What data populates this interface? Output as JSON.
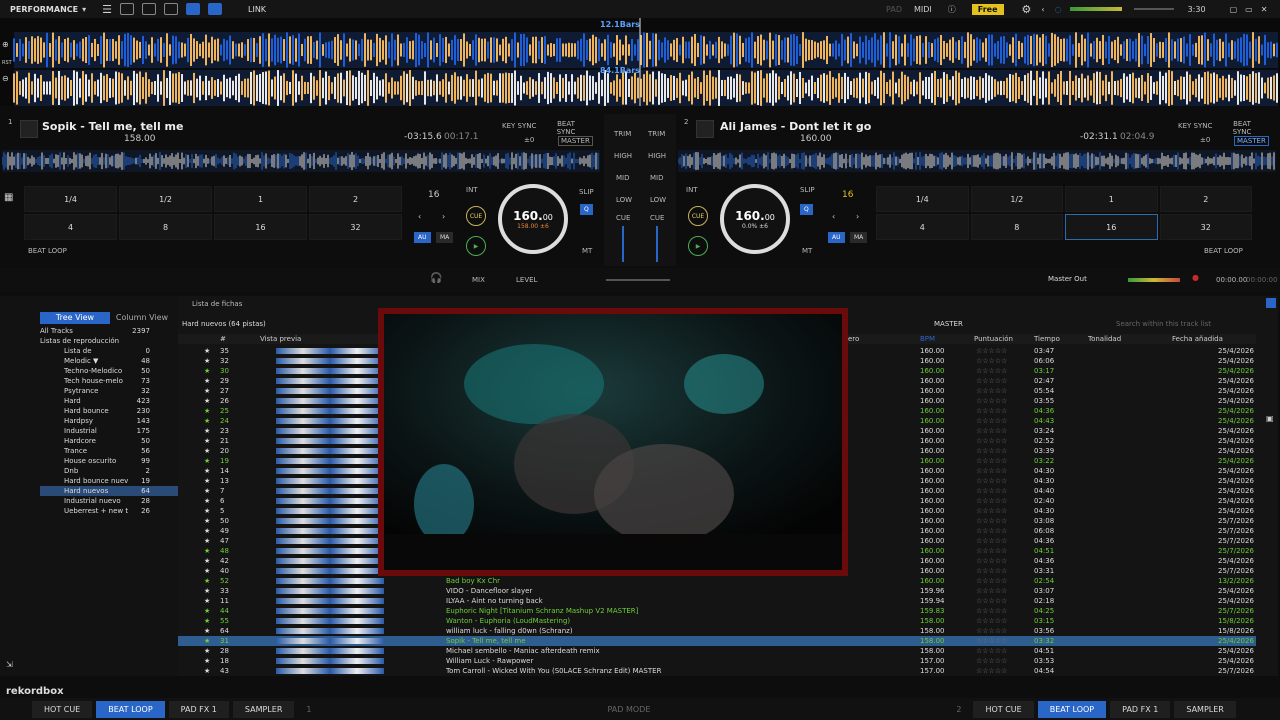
{
  "topbar": {
    "mode": "PERFORMANCE",
    "link": "LINK",
    "pad": "PAD",
    "midi": "MIDI",
    "plan": "Free",
    "time": "3:30"
  },
  "waveform": {
    "deck1_label": "12.1Bars",
    "deck2_label": "84.1Bars",
    "rst": "RST"
  },
  "deck1": {
    "number": "1",
    "title": "Sopik - Tell me, tell me",
    "bpm": "158.00",
    "remain": "-03:15.6",
    "elapsed": "00:17.1",
    "key_sync": "KEY SYNC",
    "beat_sync": "BEAT SYNC",
    "pm": "±0",
    "master": "MASTER",
    "jog_bpm": "160.",
    "jog_dec": "00",
    "jog_sub": "158.00 ±6",
    "loop": "16",
    "int": "INT",
    "slip": "SLIP",
    "cue": "CUE",
    "q": "Q",
    "au": "AU",
    "ma": "MA",
    "mt": "MT",
    "beat_loop": "BEAT LOOP",
    "pads": [
      "1/4",
      "1/2",
      "1",
      "2",
      "4",
      "8",
      "16",
      "32"
    ]
  },
  "deck2": {
    "number": "2",
    "title": "Ali James - Dont let it go",
    "bpm": "160.00",
    "remain": "-02:31.1",
    "elapsed": "02:04.9",
    "key_sync": "KEY SYNC",
    "beat_sync": "BEAT SYNC",
    "pm": "±0",
    "master": "MASTER",
    "jog_bpm": "160.",
    "jog_dec": "00",
    "jog_sub": "0.0% ±6",
    "loop": "16",
    "int": "INT",
    "slip": "SLIP",
    "cue": "CUE",
    "q": "Q",
    "au": "AU",
    "ma": "MA",
    "mt": "MT",
    "beat_loop": "BEAT LOOP",
    "pads": [
      "1/4",
      "1/2",
      "1",
      "2",
      "4",
      "8",
      "16",
      "32"
    ]
  },
  "mixer": {
    "trim": "TRIM",
    "high": "HIGH",
    "mid": "MID",
    "low": "LOW",
    "cue": "CUE",
    "mix": "MIX",
    "level": "LEVEL",
    "master_out": "Master Out",
    "rec_time": "00:00.00",
    "rec_time2": "00:00:00"
  },
  "browser": {
    "tree_view": "Tree View",
    "column_view": "Column View",
    "list_header": "Lista de fichas",
    "playlist_name": "Hard nuevos (64 pistas)",
    "master": "MASTER",
    "search_placeholder": "Search within this track list",
    "tree": [
      {
        "name": "All Tracks",
        "count": "2397"
      },
      {
        "name": "Listas de reproducción",
        "count": ""
      },
      {
        "name": "Lista de",
        "count": "0"
      },
      {
        "name": "Melodic ▼",
        "count": "48"
      },
      {
        "name": "Techno-Melodico",
        "count": "50"
      },
      {
        "name": "Tech house-melo",
        "count": "73"
      },
      {
        "name": "Psytrance",
        "count": "32"
      },
      {
        "name": "Hard",
        "count": "423"
      },
      {
        "name": "Hard bounce",
        "count": "230"
      },
      {
        "name": "Hardpsy",
        "count": "143"
      },
      {
        "name": "Industrial",
        "count": "175"
      },
      {
        "name": "Hardcore",
        "count": "50"
      },
      {
        "name": "Trance",
        "count": "56"
      },
      {
        "name": "House oscurito",
        "count": "99"
      },
      {
        "name": "Dnb",
        "count": "2"
      },
      {
        "name": "Hard bounce nuev",
        "count": "19"
      },
      {
        "name": "Hard nuevos",
        "count": "64"
      },
      {
        "name": "Industrial nuevo",
        "count": "28"
      },
      {
        "name": "Ueberrest + new t",
        "count": "26"
      }
    ],
    "columns": [
      "#",
      "Vista previa",
      "ero",
      "BPM",
      "Puntuación",
      "Tiempo",
      "Tonalidad",
      "Fecha añadida"
    ],
    "rows": [
      {
        "n": "35",
        "title": "",
        "bpm": "160.00",
        "time": "03:47",
        "date": "25/4/2026",
        "green": false
      },
      {
        "n": "32",
        "title": "",
        "bpm": "160.00",
        "time": "06:06",
        "date": "25/4/2026",
        "green": false
      },
      {
        "n": "30",
        "title": "",
        "bpm": "160.00",
        "time": "03:17",
        "date": "25/4/2026",
        "green": true
      },
      {
        "n": "29",
        "title": "",
        "bpm": "160.00",
        "time": "02:47",
        "date": "25/4/2026",
        "green": false
      },
      {
        "n": "27",
        "title": "",
        "bpm": "160.00",
        "time": "05:54",
        "date": "25/4/2026",
        "green": false
      },
      {
        "n": "26",
        "title": "",
        "bpm": "160.00",
        "time": "03:55",
        "date": "25/4/2026",
        "green": false
      },
      {
        "n": "25",
        "title": "",
        "bpm": "160.00",
        "time": "04:36",
        "date": "25/4/2026",
        "green": true
      },
      {
        "n": "24",
        "title": "",
        "bpm": "160.00",
        "time": "04:43",
        "date": "25/4/2026",
        "green": true
      },
      {
        "n": "23",
        "title": "",
        "bpm": "160.00",
        "time": "03:24",
        "date": "25/4/2026",
        "green": false
      },
      {
        "n": "21",
        "title": "",
        "bpm": "160.00",
        "time": "02:52",
        "date": "25/4/2026",
        "green": false
      },
      {
        "n": "20",
        "title": "",
        "bpm": "160.00",
        "time": "03:39",
        "date": "25/4/2026",
        "green": false
      },
      {
        "n": "19",
        "title": "",
        "bpm": "160.00",
        "time": "03:22",
        "date": "25/4/2026",
        "green": true
      },
      {
        "n": "14",
        "title": "",
        "bpm": "160.00",
        "time": "04:30",
        "date": "25/4/2026",
        "green": false
      },
      {
        "n": "13",
        "title": "",
        "bpm": "160.00",
        "time": "04:30",
        "date": "25/4/2026",
        "green": false
      },
      {
        "n": "7",
        "title": "",
        "bpm": "160.00",
        "time": "04:40",
        "date": "25/4/2026",
        "green": false
      },
      {
        "n": "6",
        "title": "",
        "bpm": "160.00",
        "time": "02:40",
        "date": "25/4/2026",
        "green": false
      },
      {
        "n": "5",
        "title": "",
        "bpm": "160.00",
        "time": "04:30",
        "date": "25/4/2026",
        "green": false
      },
      {
        "n": "50",
        "title": "",
        "bpm": "160.00",
        "time": "03:08",
        "date": "25/7/2026",
        "green": false
      },
      {
        "n": "49",
        "title": "",
        "bpm": "160.00",
        "time": "06:08",
        "date": "25/7/2026",
        "green": false
      },
      {
        "n": "47",
        "title": "",
        "bpm": "160.00",
        "time": "04:36",
        "date": "25/7/2026",
        "green": false
      },
      {
        "n": "48",
        "title": "",
        "bpm": "160.00",
        "time": "04:51",
        "date": "25/7/2026",
        "green": true
      },
      {
        "n": "42",
        "title": "",
        "bpm": "160.00",
        "time": "04:36",
        "date": "25/4/2026",
        "green": false
      },
      {
        "n": "40",
        "title": "",
        "bpm": "160.00",
        "time": "03:31",
        "date": "25/7/2026",
        "green": false
      },
      {
        "n": "52",
        "title": "Bad boy Kx Chr",
        "bpm": "160.00",
        "time": "02:54",
        "date": "13/2/2026",
        "green": true
      },
      {
        "n": "33",
        "title": "VIDO - Dancefloor slayer",
        "bpm": "159.96",
        "time": "03:07",
        "date": "25/4/2026",
        "green": false
      },
      {
        "n": "11",
        "title": "ILYAA - Aint no turning back",
        "bpm": "159.94",
        "time": "02:18",
        "date": "25/4/2026",
        "green": false
      },
      {
        "n": "44",
        "title": "Euphoric Night [Titanium Schranz Mashup V2 MASTER]",
        "bpm": "159.83",
        "time": "04:25",
        "date": "25/7/2026",
        "green": true
      },
      {
        "n": "55",
        "title": "Wanton - Euphoria (LoudMastering)",
        "bpm": "158.00",
        "time": "03:15",
        "date": "15/8/2026",
        "green": true
      },
      {
        "n": "64",
        "title": "william luck - falling d0wn (Schranz)",
        "bpm": "158.00",
        "time": "03:56",
        "date": "15/8/2026",
        "green": false
      },
      {
        "n": "31",
        "title": "Sopik - Tell me, tell me",
        "bpm": "158.00",
        "time": "03:32",
        "date": "25/4/2026",
        "green": true,
        "sel": true
      },
      {
        "n": "28",
        "title": "Michael sembello - Maniac afterdeath remix",
        "bpm": "158.00",
        "time": "04:51",
        "date": "25/4/2026",
        "green": false
      },
      {
        "n": "18",
        "title": "William Luck - Rawpower",
        "bpm": "157.00",
        "time": "03:53",
        "date": "25/4/2026",
        "green": false
      },
      {
        "n": "43",
        "title": "Tom Carroll - Wicked With You (S0LACE Schranz Edit) MASTER",
        "bpm": "157.00",
        "time": "04:54",
        "date": "25/7/2026",
        "green": false
      }
    ]
  },
  "bottom": {
    "left_deck": "1",
    "right_deck": "2",
    "pad_mode": "PAD MODE",
    "buttons": [
      "HOT CUE",
      "BEAT LOOP",
      "PAD FX 1",
      "SAMPLER"
    ],
    "brand": "rekordbox"
  },
  "colors": {
    "accent_blue": "#2a66c8",
    "wave_orange": "#f0b45a",
    "wave_blue": "#1e5fd8",
    "green_text": "#6ecf3a",
    "overlay_border": "#6b0a0a"
  }
}
